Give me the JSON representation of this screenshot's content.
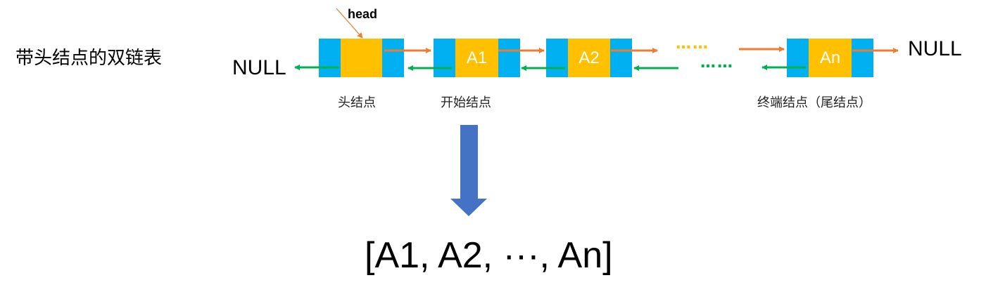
{
  "title": "带头结点的双链表",
  "head_label": "head",
  "null_left": "NULL",
  "null_right": "NULL",
  "nodes": [
    {
      "data": ""
    },
    {
      "data": "A1"
    },
    {
      "data": "A2"
    },
    {
      "data": "An"
    }
  ],
  "ellipsis_top": "……",
  "ellipsis_bottom": "……",
  "captions": {
    "head_node": "头结点",
    "start_node": "开始结点",
    "tail_node": "终端结点（尾结点）"
  },
  "result": "[A1, A2, ···, An]",
  "colors": {
    "pointer_field": "#00b0f0",
    "data_field": "#ffc000",
    "next_arrow": "#ed7d31",
    "prev_arrow": "#00b050",
    "down_arrow": "#4472c4",
    "head_pointer": "#ed7d31"
  }
}
